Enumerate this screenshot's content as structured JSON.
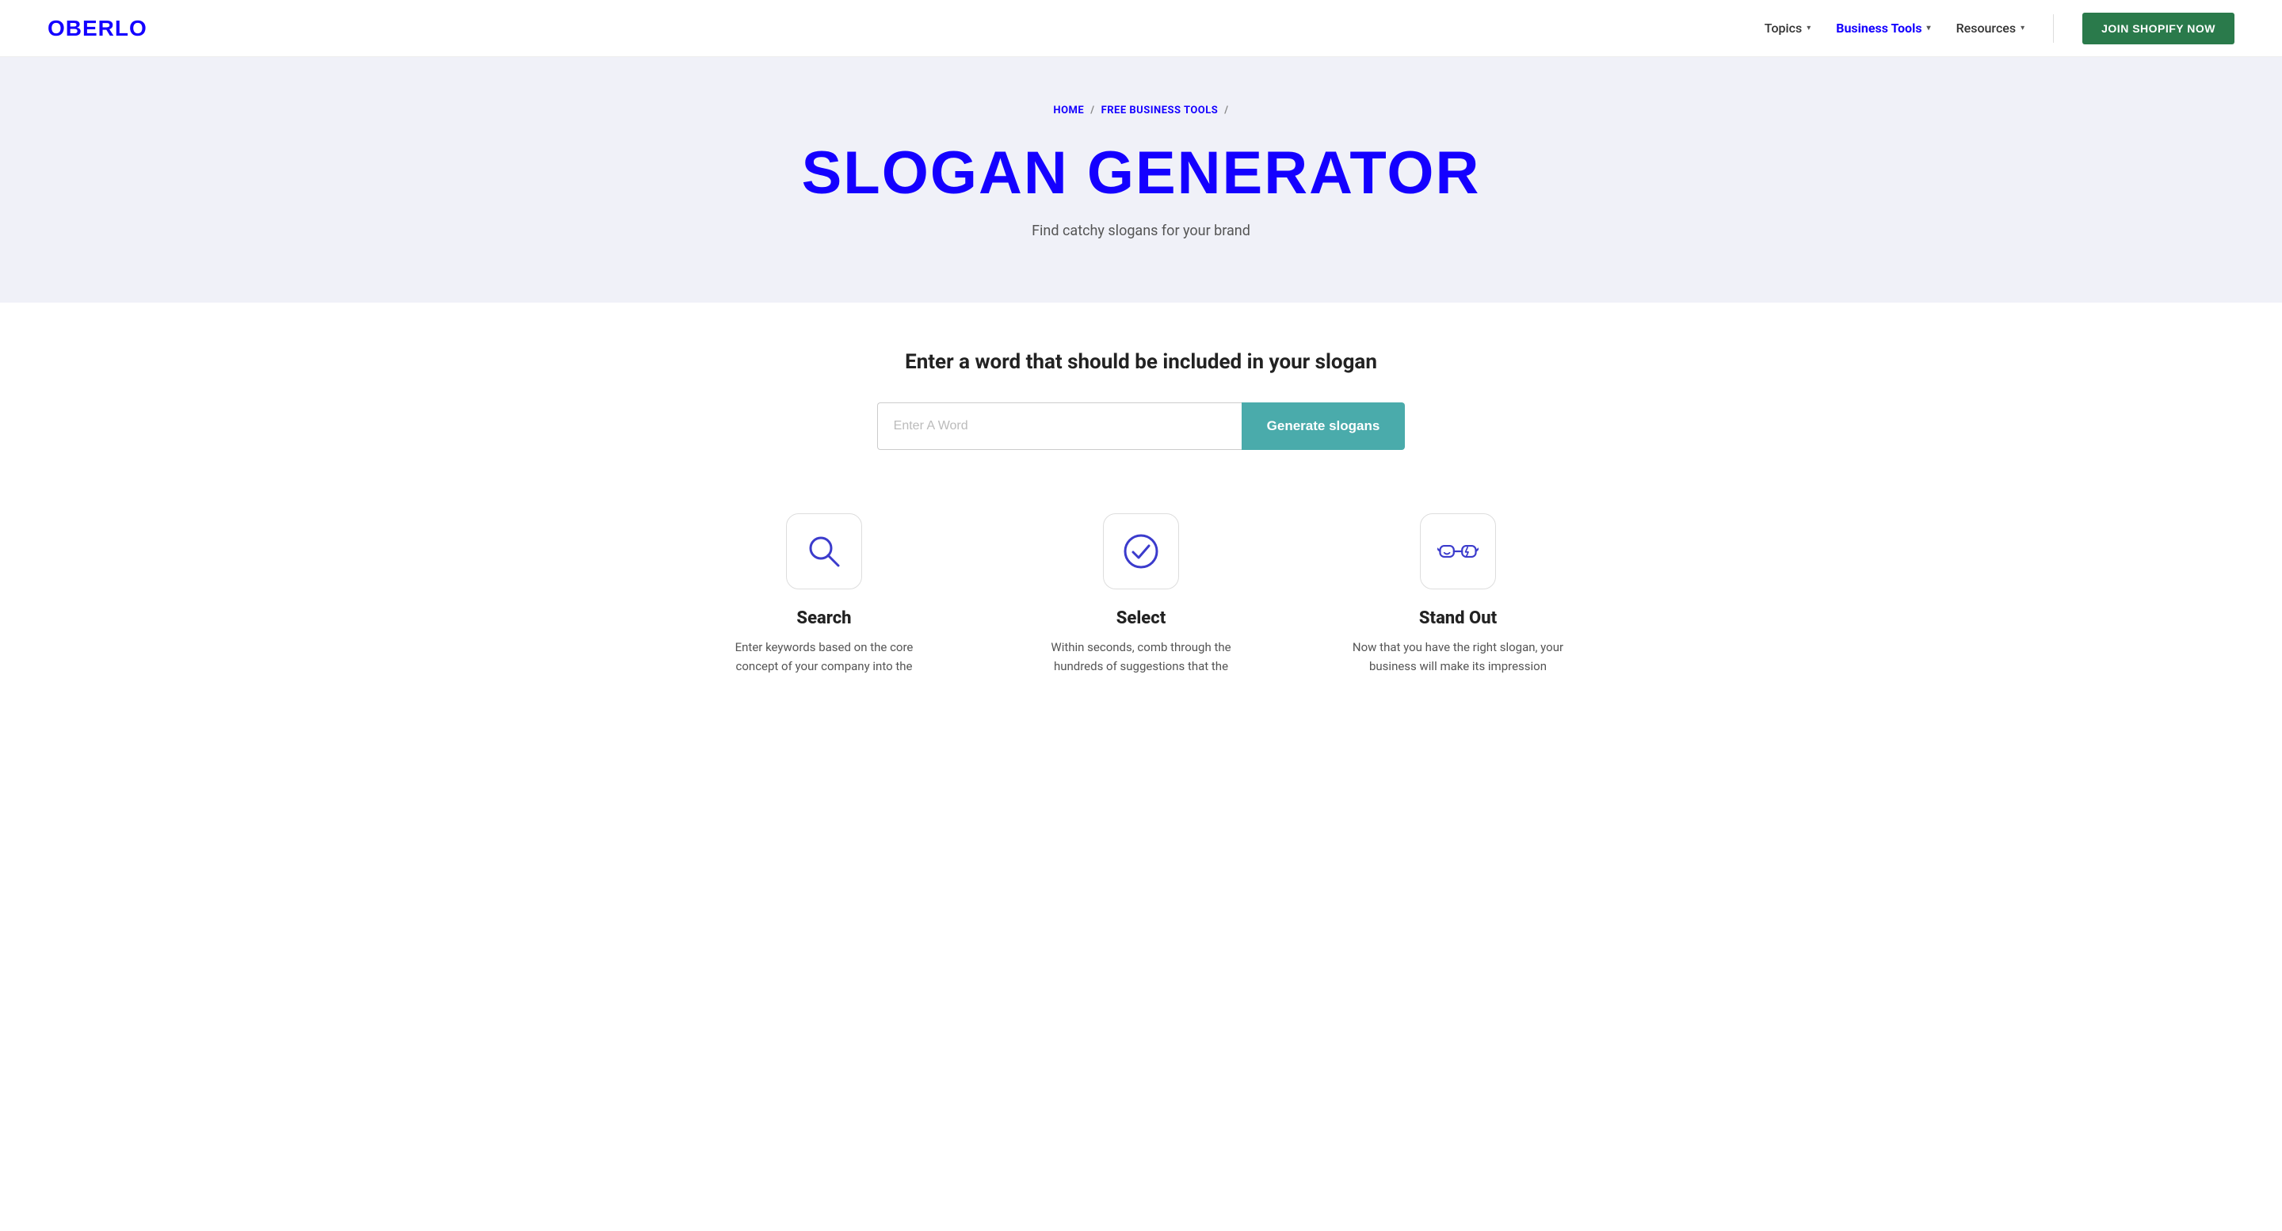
{
  "navbar": {
    "logo": "OBERLO",
    "links": [
      {
        "label": "Topics",
        "active": false,
        "id": "topics"
      },
      {
        "label": "Business Tools",
        "active": true,
        "id": "business-tools"
      },
      {
        "label": "Resources",
        "active": false,
        "id": "resources"
      }
    ],
    "join_button": "JOIN SHOPIFY NOW"
  },
  "breadcrumb": {
    "items": [
      {
        "label": "HOME",
        "id": "home"
      },
      {
        "separator": "/"
      },
      {
        "label": "FREE BUSINESS TOOLS",
        "id": "free-business-tools"
      },
      {
        "separator": "/"
      }
    ]
  },
  "hero": {
    "title": "SLOGAN GENERATOR",
    "subtitle": "Find catchy slogans for your brand"
  },
  "generator": {
    "heading": "Enter a word that should be included in your slogan",
    "input_placeholder": "Enter A Word",
    "button_label": "Generate slogans"
  },
  "features": [
    {
      "id": "search",
      "icon": "search",
      "title": "Search",
      "description": "Enter keywords based on the core concept of your company into the"
    },
    {
      "id": "select",
      "icon": "checkmark",
      "title": "Select",
      "description": "Within seconds, comb through the hundreds of suggestions that the"
    },
    {
      "id": "stand-out",
      "icon": "glasses",
      "title": "Stand Out",
      "description": "Now that you have the right slogan, your business will make its impression"
    }
  ],
  "colors": {
    "brand_blue": "#1400ff",
    "brand_green": "#2a7a4b",
    "teal": "#4aabab",
    "hero_bg": "#f0f1f8"
  }
}
